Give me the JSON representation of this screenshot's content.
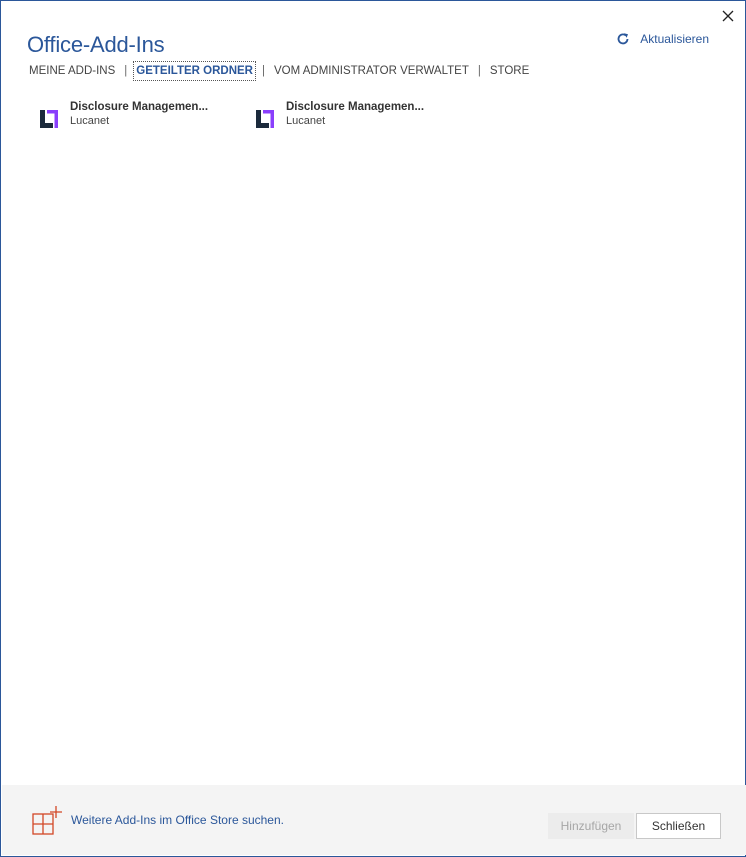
{
  "dialog": {
    "title": "Office-Add-Ins",
    "refresh_label": "Aktualisieren"
  },
  "tabs": [
    {
      "label": "MEINE ADD-INS",
      "active": false
    },
    {
      "label": "GETEILTER ORDNER",
      "active": true
    },
    {
      "label": "VOM ADMINISTRATOR VERWALTET",
      "active": false
    },
    {
      "label": "STORE",
      "active": false
    }
  ],
  "tab_separator": "|",
  "addins": [
    {
      "name": "Disclosure Managemen...",
      "publisher": "Lucanet",
      "icon": "lucanet-logo-icon"
    },
    {
      "name": "Disclosure Managemen...",
      "publisher": "Lucanet",
      "icon": "lucanet-logo-icon"
    }
  ],
  "footer": {
    "store_link_label": "Weitere Add-Ins im Office Store suchen.",
    "add_button_label": "Hinzufügen",
    "close_button_label": "Schließen"
  },
  "colors": {
    "accent": "#2b579a",
    "logo_dark": "#1b2a3c",
    "logo_purple": "#8a3ffc",
    "store_icon": "#d24726"
  },
  "icons": {
    "close": "close-icon",
    "refresh": "refresh-icon",
    "store": "store-add-icon"
  }
}
